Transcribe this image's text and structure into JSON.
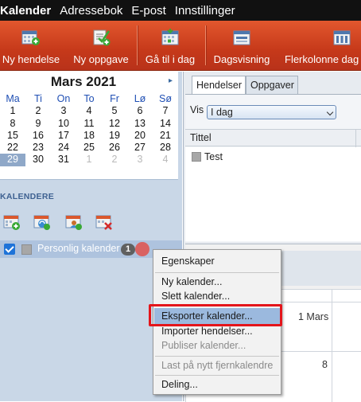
{
  "topbar": {
    "items": [
      "Kalender",
      "Adressebok",
      "E-post",
      "Innstillinger"
    ]
  },
  "toolbar": {
    "buttons": [
      {
        "label": "Ny hendelse",
        "icon": "new-event-icon"
      },
      {
        "label": "Ny oppgave",
        "icon": "new-task-icon"
      },
      {
        "label": "Gå til i dag",
        "icon": "today-icon"
      },
      {
        "label": "Dagsvisning",
        "icon": "day-view-icon"
      },
      {
        "label": "Flerkolonne dag",
        "icon": "multi-column-icon"
      }
    ]
  },
  "mini_calendar": {
    "title": "Mars 2021",
    "next": "▸",
    "weekdays": [
      "Ma",
      "Ti",
      "On",
      "To",
      "Fr",
      "Lø",
      "Sø"
    ],
    "weeks": [
      [
        "1",
        "2",
        "3",
        "4",
        "5",
        "6",
        "7"
      ],
      [
        "8",
        "9",
        "10",
        "11",
        "12",
        "13",
        "14"
      ],
      [
        "15",
        "16",
        "17",
        "18",
        "19",
        "20",
        "21"
      ],
      [
        "22",
        "23",
        "24",
        "25",
        "26",
        "27",
        "28"
      ],
      [
        "29",
        "30",
        "31",
        "1",
        "2",
        "3",
        "4"
      ]
    ],
    "today": "29"
  },
  "calendars": {
    "section_label": "KALENDERE",
    "personal": {
      "label": "Personlig kalender",
      "count": "1"
    }
  },
  "tabs": {
    "events": "Hendelser",
    "tasks": "Oppgaver"
  },
  "filter": {
    "label": "Vis",
    "value": "I dag"
  },
  "task_list": {
    "column_title": "Tittel",
    "items": [
      "Test"
    ]
  },
  "calendar_view": {
    "date_first": "1 Mars",
    "date_second": "8"
  },
  "context_menu": {
    "properties": "Egenskaper",
    "new_calendar": "Ny kalender...",
    "delete_calendar": "Slett kalender...",
    "export_calendar": "Eksporter kalender...",
    "import_events": "Importer hendelser...",
    "publish_calendar": "Publiser kalender...",
    "reload_remote": "Last på nytt fjernkalendre",
    "sharing": "Deling..."
  },
  "colors": {
    "toolbar": "#c6391a",
    "highlight_box": "#e4151b",
    "menu_hover": "#9bb9de"
  }
}
